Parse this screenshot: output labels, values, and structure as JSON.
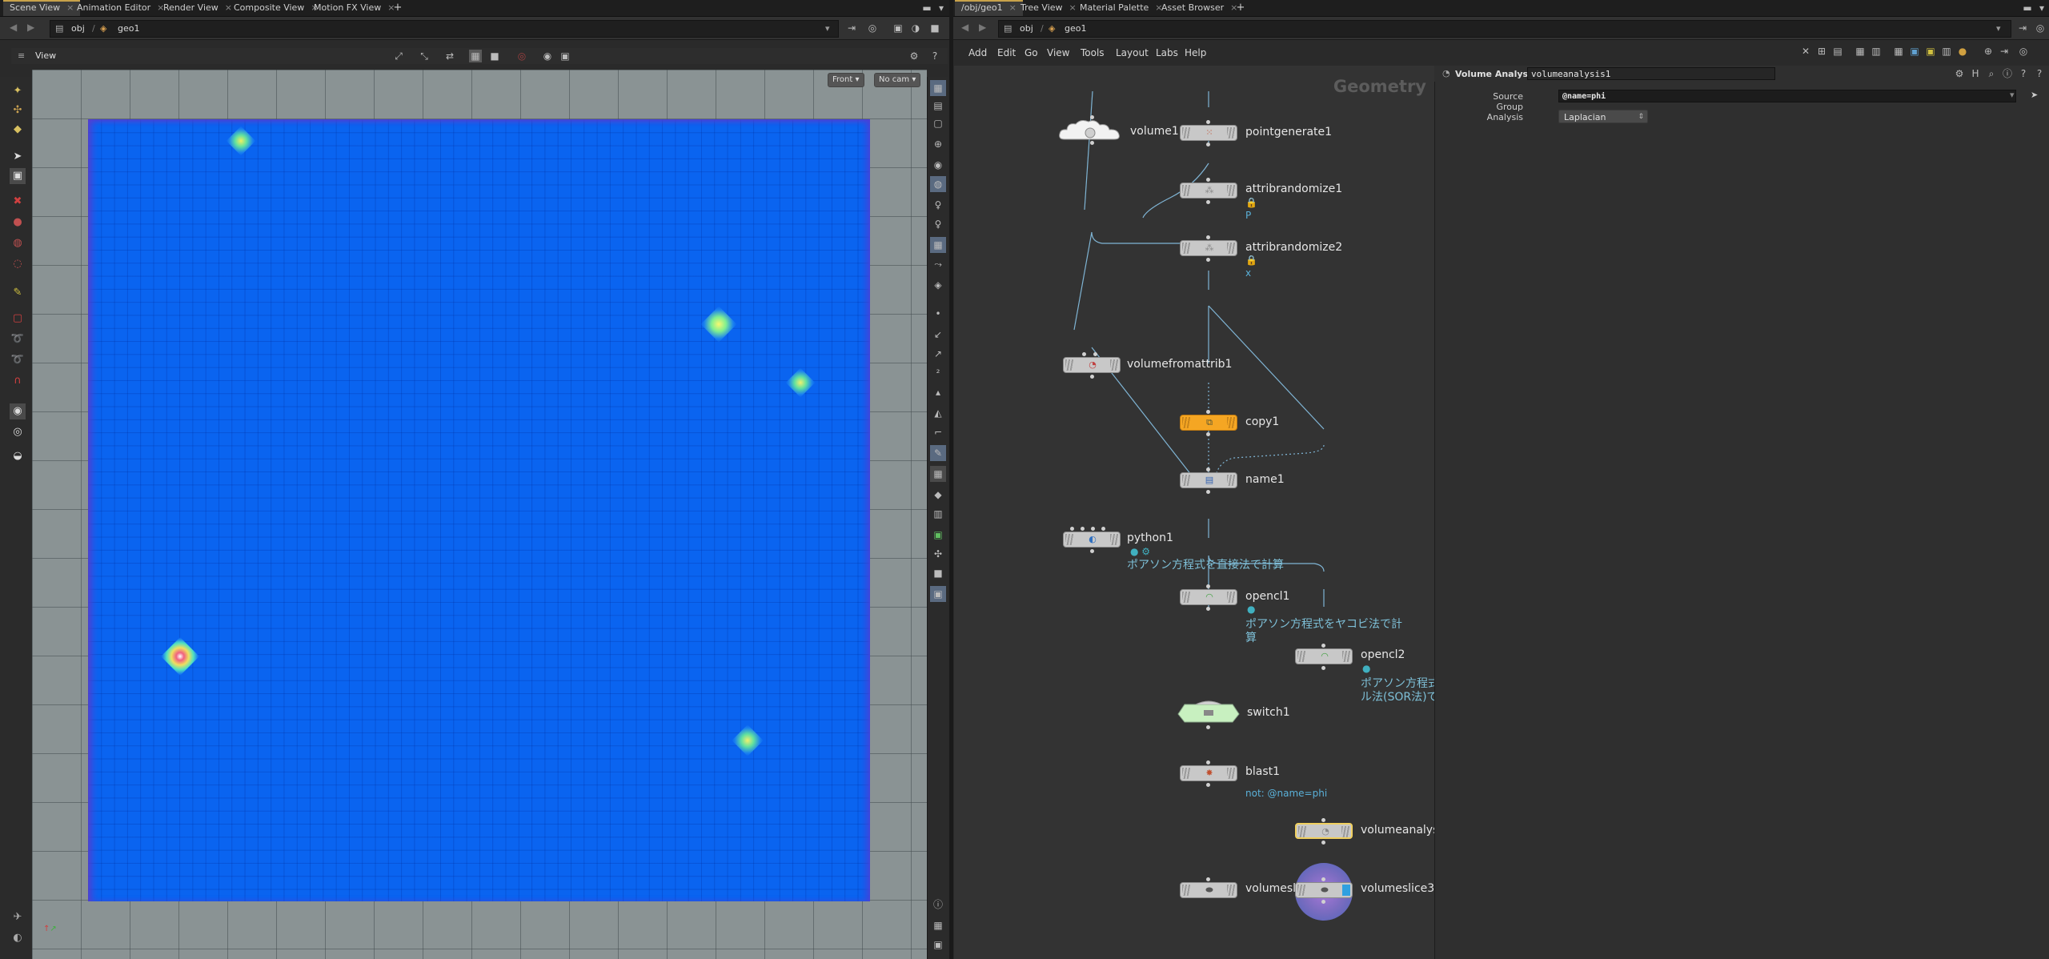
{
  "left_tabs": [
    "Scene View",
    "Animation Editor",
    "Render View",
    "Composite View",
    "Motion FX View"
  ],
  "right_tabs": [
    "/obj/geo1",
    "Tree View",
    "Material Palette",
    "Asset Browser"
  ],
  "left_path": {
    "obj": "obj",
    "geo": "geo1"
  },
  "right_path": {
    "obj": "obj",
    "geo": "geo1"
  },
  "viewer": {
    "title": "View",
    "front_btn": "Front",
    "cam_btn": "No cam"
  },
  "menu": [
    "Add",
    "Edit",
    "Go",
    "View",
    "Tools",
    "Layout",
    "Labs",
    "Help"
  ],
  "network": {
    "context": "Geometry",
    "nodes": {
      "volume1": "volume1",
      "pointgenerate1": "pointgenerate1",
      "attribrandomize1": "attribrandomize1",
      "attribrandomize1_sub": "P",
      "attribrandomize2": "attribrandomize2",
      "attribrandomize2_sub": "x",
      "volumefromattrib1": "volumefromattrib1",
      "copy1": "copy1",
      "name1": "name1",
      "python1": "python1",
      "opencl1": "opencl1",
      "opencl2": "opencl2",
      "switch1": "switch1",
      "blast1": "blast1",
      "blast1_sub": "not: @name=phi",
      "volumeanalysis": "volumeanalys",
      "volumeslice_left": "volumesli",
      "volumeslice3": "volumeslice3"
    },
    "comments": {
      "python1": "ポアソン方程式を直接法で計算",
      "opencl1_a": "ポアソン方程式をヤコビ法で計",
      "opencl1_b": "算",
      "opencl2_a": "ポアソン方程式",
      "opencl2_b": "ル法(SOR法)で"
    }
  },
  "params": {
    "node_type": "Volume Analysis",
    "node_name": "volumeanalysis1",
    "source_group_label": "Source Group",
    "source_group_value": "@name=phi",
    "analysis_label": "Analysis",
    "analysis_value": "Laplacian"
  },
  "colors": {
    "copy_node": "#f5a623",
    "switch_node": "#c8f0c0",
    "plane": "#0a64f0",
    "selected": "#f0d060"
  }
}
